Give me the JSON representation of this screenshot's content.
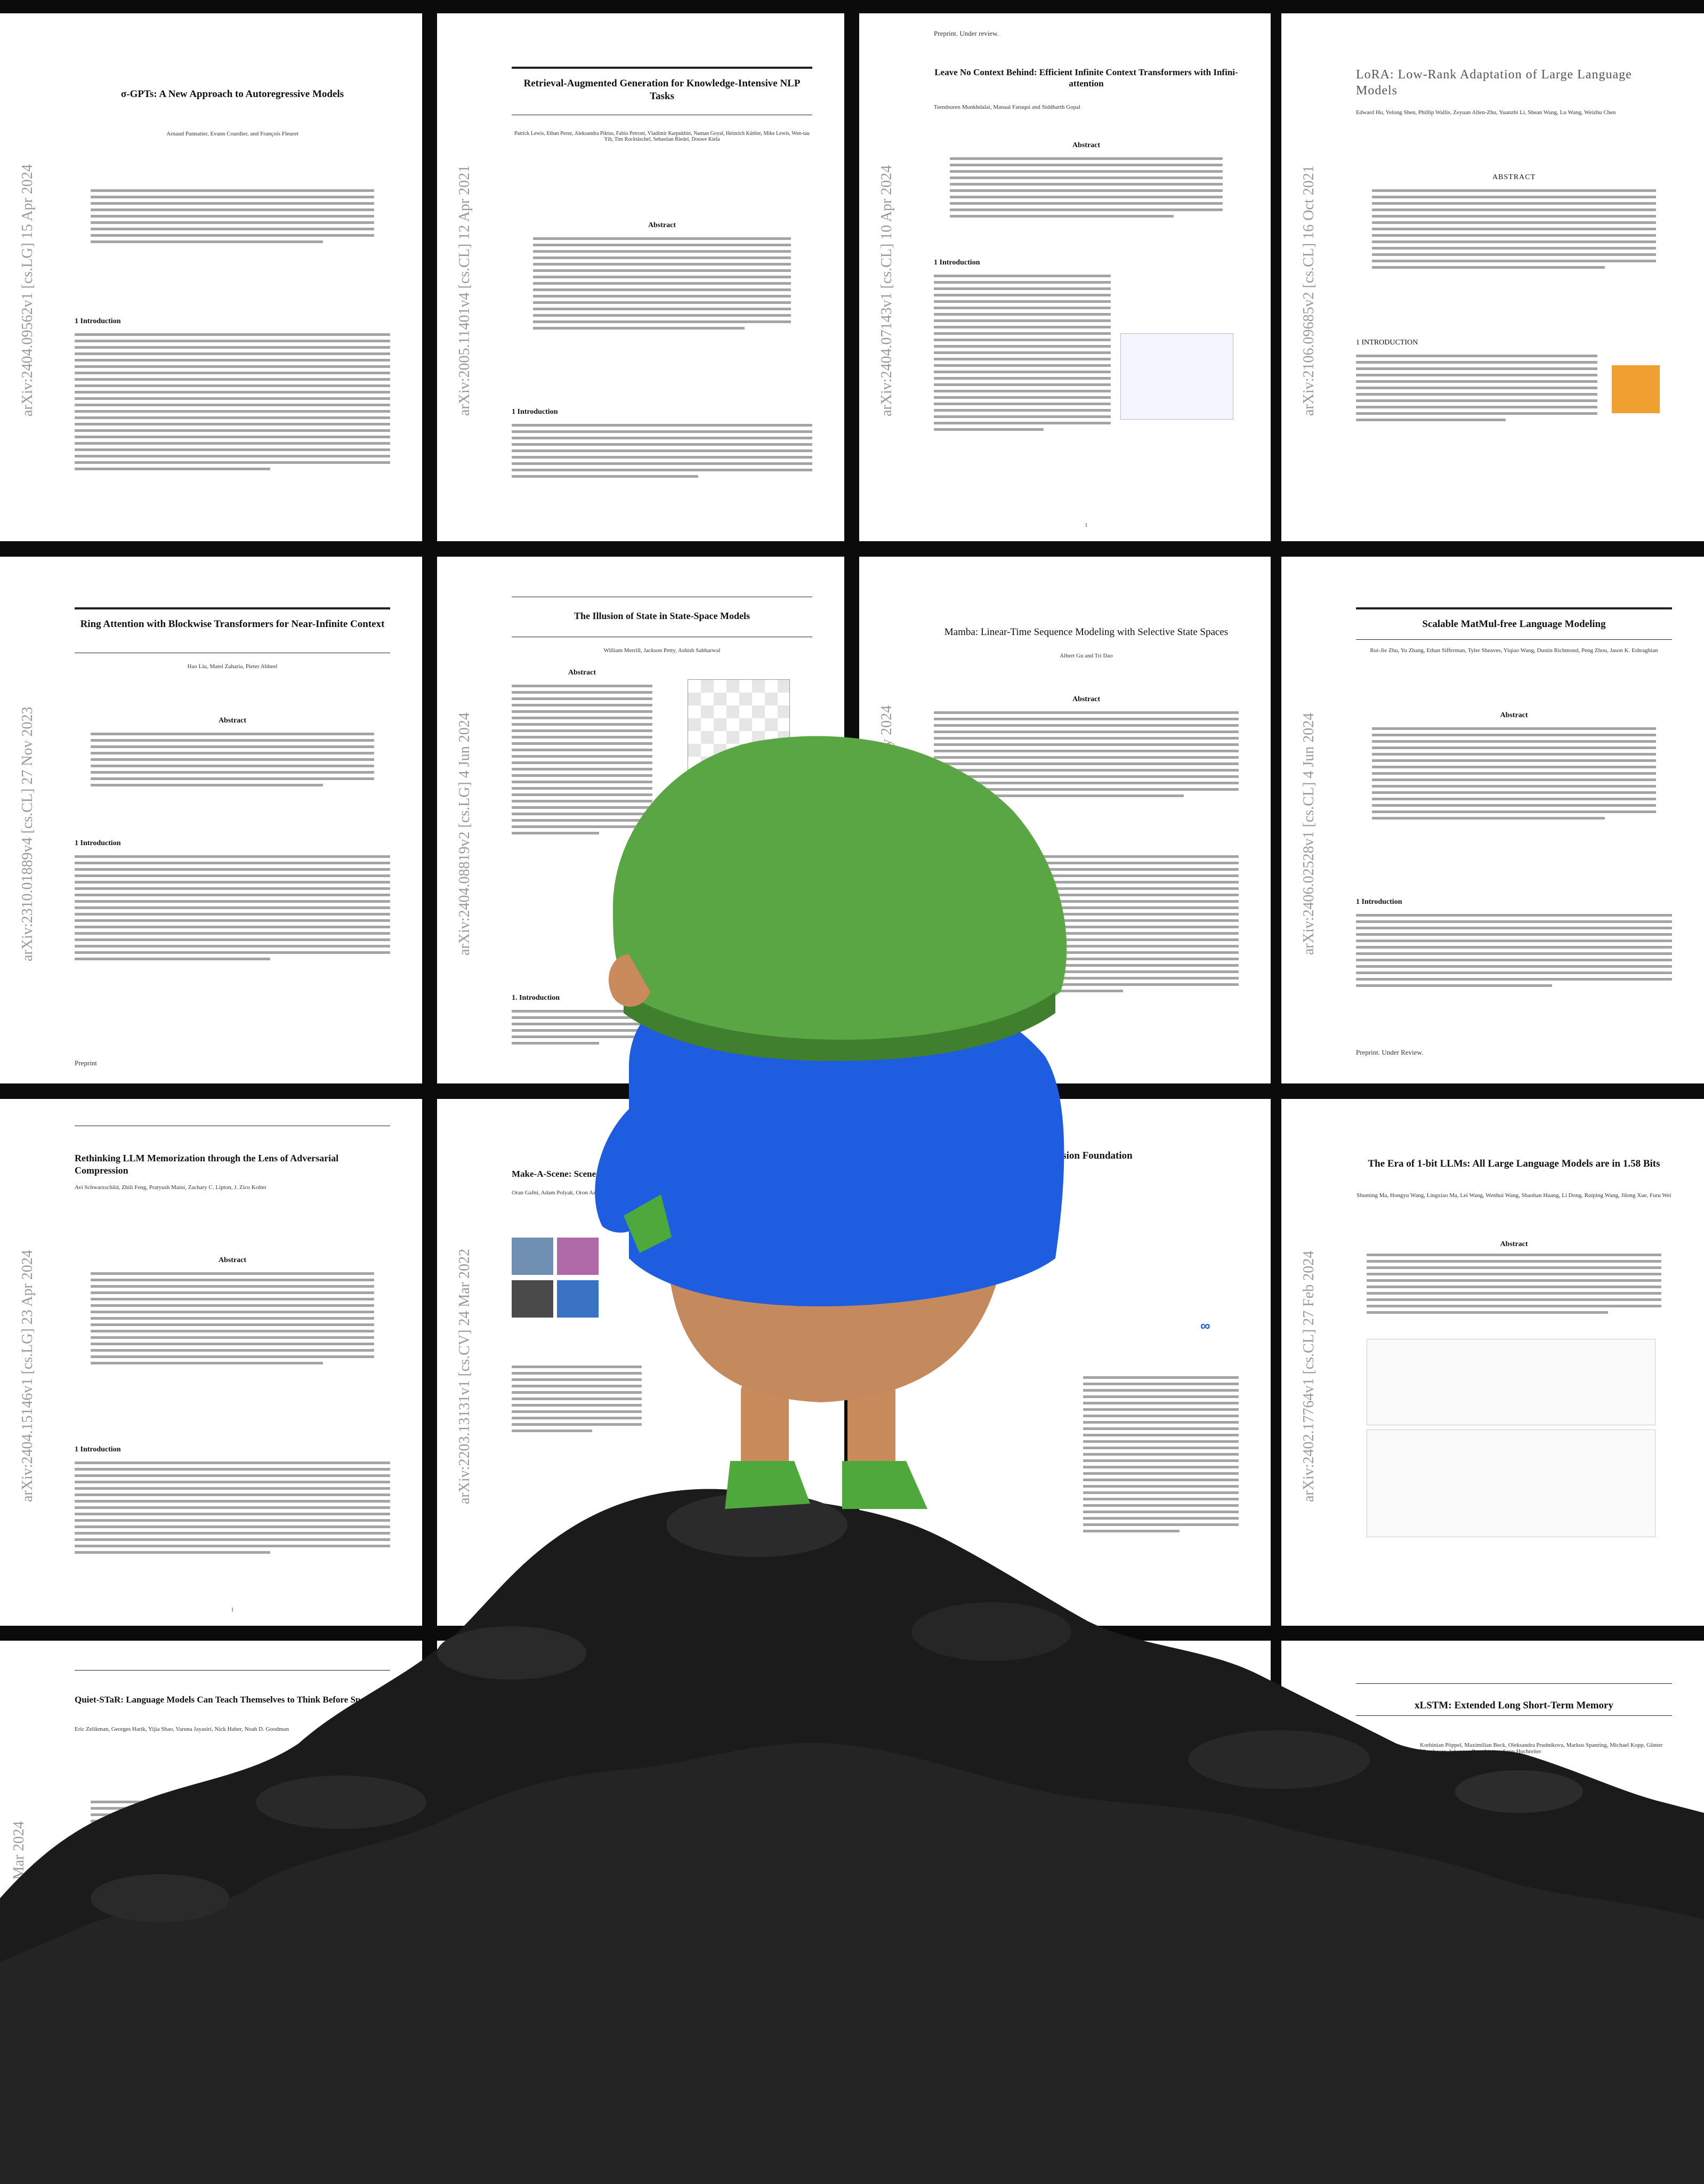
{
  "papers": [
    {
      "id": "sigma-gpts",
      "arxiv": "arXiv:2404.09562v1  [cs.LG]  15 Apr 2024",
      "title": "σ-GPTs: A New Approach to Autoregressive Models",
      "authors": "Arnaud Pannatier, Evann Courdier, and François Fleuret",
      "page": ""
    },
    {
      "id": "rag",
      "arxiv": "arXiv:2005.11401v4  [cs.CL]  12 Apr 2021",
      "title": "Retrieval-Augmented Generation for Knowledge-Intensive NLP Tasks",
      "authors": "Patrick Lewis, Ethan Perez, Aleksandra Piktus, Fabio Petroni, Vladimir Karpukhin, Naman Goyal, Heinrich Küttler, Mike Lewis, Wen-tau Yih, Tim Rocktäschel, Sebastian Riedel, Douwe Kiela",
      "page": ""
    },
    {
      "id": "infini-attention",
      "arxiv": "arXiv:2404.07143v1  [cs.CL]  10 Apr 2024",
      "title": "Leave No Context Behind: Efficient Infinite Context Transformers with Infini-attention",
      "authors": "Tsendsuren Munkhdalai, Manaal Faruqui and Siddharth Gopal",
      "preprint": "Preprint. Under review.",
      "page": "1"
    },
    {
      "id": "lora",
      "arxiv": "arXiv:2106.09685v2  [cs.CL]  16 Oct 2021",
      "title": "LoRA: Low-Rank Adaptation of Large Language Models",
      "authors": "Edward Hu, Yelong Shen, Phillip Wallis, Zeyuan Allen-Zhu, Yuanzhi Li, Shean Wang, Lu Wang, Weizhu Chen",
      "page": ""
    },
    {
      "id": "ring-attention",
      "arxiv": "arXiv:2310.01889v4  [cs.CL]  27 Nov 2023",
      "title": "Ring Attention with Blockwise Transformers for Near-Infinite Context",
      "authors": "Hao Liu, Matei Zaharia, Pieter Abbeel",
      "preprint": "Preprint",
      "page": ""
    },
    {
      "id": "illusion-of-state",
      "arxiv": "arXiv:2404.08819v2  [cs.LG]  4 Jun 2024",
      "title": "The Illusion of State in State-Space Models",
      "authors": "William Merrill, Jackson Petty, Ashish Sabharwal",
      "page": ""
    },
    {
      "id": "mamba",
      "arxiv": "arXiv:2312.00752v2  [cs.LG]  31 May 2024",
      "title": "Mamba: Linear-Time Sequence Modeling with Selective State Spaces",
      "authors": "Albert Gu and Tri Dao",
      "page": ""
    },
    {
      "id": "matmul-free",
      "arxiv": "arXiv:2406.02528v1  [cs.CL]  4 Jun 2024",
      "title": "Scalable MatMul-free Language Modeling",
      "authors": "Rui-Jie Zhu, Yu Zhang, Ethan Sifferman, Tyler Sheaves, Yiqiao Wang, Dustin Richmond, Peng Zhou, Jason K. Eshraghian",
      "preprint": "Preprint. Under Review.",
      "page": ""
    },
    {
      "id": "llm-memorization",
      "arxiv": "arXiv:2404.15146v1  [cs.LG]  23 Apr 2024",
      "title": "Rethinking LLM Memorization through the Lens of Adversarial Compression",
      "authors": "Avi Schwarzschild, Zhili Feng, Pratyush Maini, Zachary C. Lipton, J. Zico Kolter",
      "page": "1"
    },
    {
      "id": "make-a-scene",
      "arxiv": "arXiv:2203.13131v1  [cs.CV]  24 Mar 2022",
      "title": "Make-A-Scene: Scene-Based Text-",
      "authors": "Oran Gafni, Adam Polyak, Oron Ashual",
      "page": ""
    },
    {
      "id": "chameleon",
      "arxiv": "",
      "title": "arly-Fusion Foundation",
      "authors": "",
      "page": ""
    },
    {
      "id": "bitnet",
      "arxiv": "arXiv:2402.17764v1  [cs.CL]  27 Feb 2024",
      "title": "The Era of 1-bit LLMs: All Large Language Models are in 1.58 Bits",
      "authors": "Shuming Ma, Hongyu Wang, Lingxiao Ma, Lei Wang, Wenhui Wang, Shaohan Huang, Li Dong, Ruiping Wang, Jilong Xue, Furu Wei",
      "page": ""
    },
    {
      "id": "quiet-star",
      "arxiv": "3.09629v2  [cs.CL]  18 Mar 2024",
      "title": "Quiet-STaR: Language Models Can Teach Themselves to Think Before Speaking",
      "authors": "Eric Zelikman, Georges Harik, Yijia Shao, Varuna Jayasiri, Nick Haber, Noah D. Goodman",
      "page": ""
    },
    {
      "id": "xlstm",
      "arxiv": "",
      "title": "xLSTM: Extended Long Short-Term Memory",
      "authors": "Korbinian Pöppel, Maximilian Beck, Oleksandra Prudnikova, Markus Spanring, Michael Kopp, Günter Klambauer, Johannes Brandstetter, Sepp Hochreiter",
      "page": ""
    }
  ],
  "labels": {
    "abstract": "Abstract",
    "introduction": "1 Introduction",
    "introduction_alt": "1. Introduction",
    "introduction_caps": "1 INTRODUCTION",
    "abstract_caps": "ABSTRACT"
  },
  "colors": {
    "background": "#0b0b0b",
    "page": "#ffffff",
    "hat": "#5aa544",
    "shirt": "#1e5de0",
    "skin": "#c98b5c",
    "shoes": "#4fa83c",
    "rock": "#1c1c1c"
  }
}
